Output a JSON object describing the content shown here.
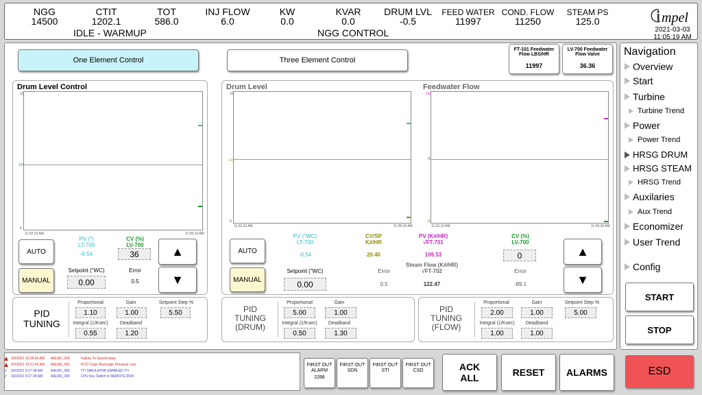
{
  "header": {
    "metrics": [
      {
        "label": "NGG",
        "value": "14500"
      },
      {
        "label": "CTIT",
        "value": "1202.1"
      },
      {
        "label": "TOT",
        "value": "586.0"
      },
      {
        "label": "INJ FLOW",
        "value": "6.0"
      },
      {
        "label": "KW",
        "value": "0.0"
      },
      {
        "label": "KVAR",
        "value": "0.0"
      },
      {
        "label": "DRUM LVL",
        "value": "-0.5"
      },
      {
        "label": "FEED WATER",
        "value": "11997"
      },
      {
        "label": "COND. FLOW",
        "value": "11250"
      },
      {
        "label": "STEAM PS",
        "value": "125.0"
      }
    ],
    "mode_left": "IDLE - WARMUP",
    "mode_center": "NGG CONTROL",
    "logo_text": "mpel",
    "date": "2021-03-03",
    "time": "11:05:19 AM"
  },
  "controls": {
    "one_element": "One Element Control",
    "three_element": "Three Element Control",
    "ft101": {
      "label": "FT-101 Feedwater Flow LBS/HR",
      "value": "11997"
    },
    "lv700": {
      "label": "LV-700 Feedwater Flow Valve",
      "value": "36.36"
    }
  },
  "drum_level_control": {
    "title": "Drum Level Control",
    "chart": {
      "ticks_top": "10",
      "ticks_mid": "100",
      "ticks_bot": "0",
      "t_start": "11:02:19 AM",
      "t_end": "11:05:19 AM"
    },
    "auto": "AUTO",
    "manual": "MANUAL",
    "pv_label": "PV (\")",
    "pv_tag": "LT-700",
    "pv_value": "-0.54",
    "cv_label": "CV (%)",
    "cv_tag": "LV-700",
    "cv_value": "36",
    "setpoint_label": "Setpoint (\"WC)",
    "setpoint_value": "0.00",
    "error_label": "Error",
    "error_value": "0.5",
    "up": "▲",
    "down": "▼"
  },
  "drum_level": {
    "title": "Drum Level",
    "chart": {
      "ticks_top": "10",
      "ticks_mid": "101",
      "ticks_bot": "0",
      "t_start": "11:02:19 AM",
      "t_end": "11:05:18 AM"
    }
  },
  "feedwater_flow": {
    "title": "Feedwater Flow",
    "chart": {
      "ticks_top": "181",
      "ticks_mid": "-9",
      "ticks_bot": "-8",
      "t_start": "11:02:19 AM",
      "t_end": "11:05:18 AM"
    }
  },
  "three_element": {
    "auto": "AUTO",
    "manual": "MANUAL",
    "pv_label": "PV (\"WC)",
    "pv_tag": "LT-700",
    "pv_value": "-0.54",
    "cvsp_label": "CV/SP",
    "cvsp_unit": "K#/HR",
    "cvsp_value": "20.40",
    "pvk_label": "PV (K#/HR)",
    "pvk_tag": "√FT-701",
    "pvk_value": "109.53",
    "cv_label": "CV (%)",
    "cv_tag": "LV-700",
    "cv_value": "0",
    "setpoint_label": "Setpoint (\"WC)",
    "setpoint_value": "0.00",
    "error_label": "Error",
    "error_value": "0.5",
    "steam_label": "Steam Flow (K#/HR)",
    "steam_tag": "√FT-702",
    "steam_value": "122.47",
    "error2_label": "Error",
    "error2_value": "-89.1",
    "up": "▲",
    "down": "▼"
  },
  "pid1": {
    "title1": "PID",
    "title2": "TUNING",
    "title3": "",
    "proportional_label": "Proportional",
    "proportional": "1.10",
    "gain_label": "Gain",
    "gain": "1.00",
    "step_label": "Setpoint Step %",
    "step": "5.50",
    "integral_label": "Integral (1/Ksec)",
    "integral": "0.55",
    "deadband_label": "Deadband",
    "deadband": "1.20"
  },
  "pid2": {
    "title1": "PID",
    "title2": "TUNING",
    "title3": "(DRUM)",
    "proportional_label": "Proportional",
    "proportional": "5.00",
    "gain_label": "Gain",
    "gain": "1.00",
    "integral_label": "Integral (1/Ksec)",
    "integral": "0.50",
    "deadband_label": "Deadband",
    "deadband": "1.30"
  },
  "pid3": {
    "title1": "PID",
    "title2": "TUNING",
    "title3": "(FLOW)",
    "proportional_label": "Proportional",
    "proportional": "2.00",
    "gain_label": "Gain",
    "gain": "1.00",
    "step_label": "Setpoint Step %",
    "step": "5.00",
    "integral_label": "Integral (1/Ksec)",
    "integral": "1.00",
    "deadband_label": "Deadband",
    "deadband": "1.00"
  },
  "nav": {
    "title": "Navigation",
    "overview": "Overview",
    "start": "Start",
    "turbine": "Turbine",
    "turbine_trend": "Turbine Trend",
    "power": "Power",
    "power_trend": "Power Trend",
    "hrsg_drum": "HRSG DRUM",
    "hrsg_steam": "HRSG STEAM",
    "hrsg_trend": "HRSG Trend",
    "auxilaries": "Auxilaries",
    "aux_trend": "Aux Trend",
    "economizer": "Economizer",
    "user_trend": "User Trend",
    "config": "Config"
  },
  "side_buttons": {
    "start": "START",
    "stop": "STOP",
    "esd": "ESD"
  },
  "alarms": [
    {
      "time": "3/3/2021 10:36:54 AM",
      "tag": "AALM1_024",
      "msg": "Failure To Synchronize",
      "color": "#e0201b"
    },
    {
      "time": "3/3/2021 10:21:43 AM",
      "tag": "AALM2_265",
      "msg": "PCD Cmpr Discharge Pressure Low",
      "color": "#e0201b"
    },
    {
      "time": "3/2/2021 9:17:38 AM",
      "tag": "AALM1_383",
      "msg": "!!!!! SIMULATOR ENABLED !!!!!",
      "color": "#3a35c8"
    },
    {
      "time": "3/2/2021 9:17:38 AM",
      "tag": "AALM2_349",
      "msg": "CPU Key Switch in REMOTE RUN",
      "color": "#3a35c8"
    }
  ],
  "first_out": [
    {
      "line1": "FIRST OUT",
      "line2": "ALARM",
      "line3": "2288"
    },
    {
      "line1": "FIRST OUT",
      "line2": "SDN",
      "line3": ""
    },
    {
      "line1": "FIRST OUT",
      "line2": "STI",
      "line3": ""
    },
    {
      "line1": "FIRST OUT",
      "line2": "CSD",
      "line3": ""
    }
  ],
  "bottom_buttons": {
    "ack1": "ACK",
    "ack2": "ALL",
    "reset": "RESET",
    "alarms": "ALARMS"
  }
}
